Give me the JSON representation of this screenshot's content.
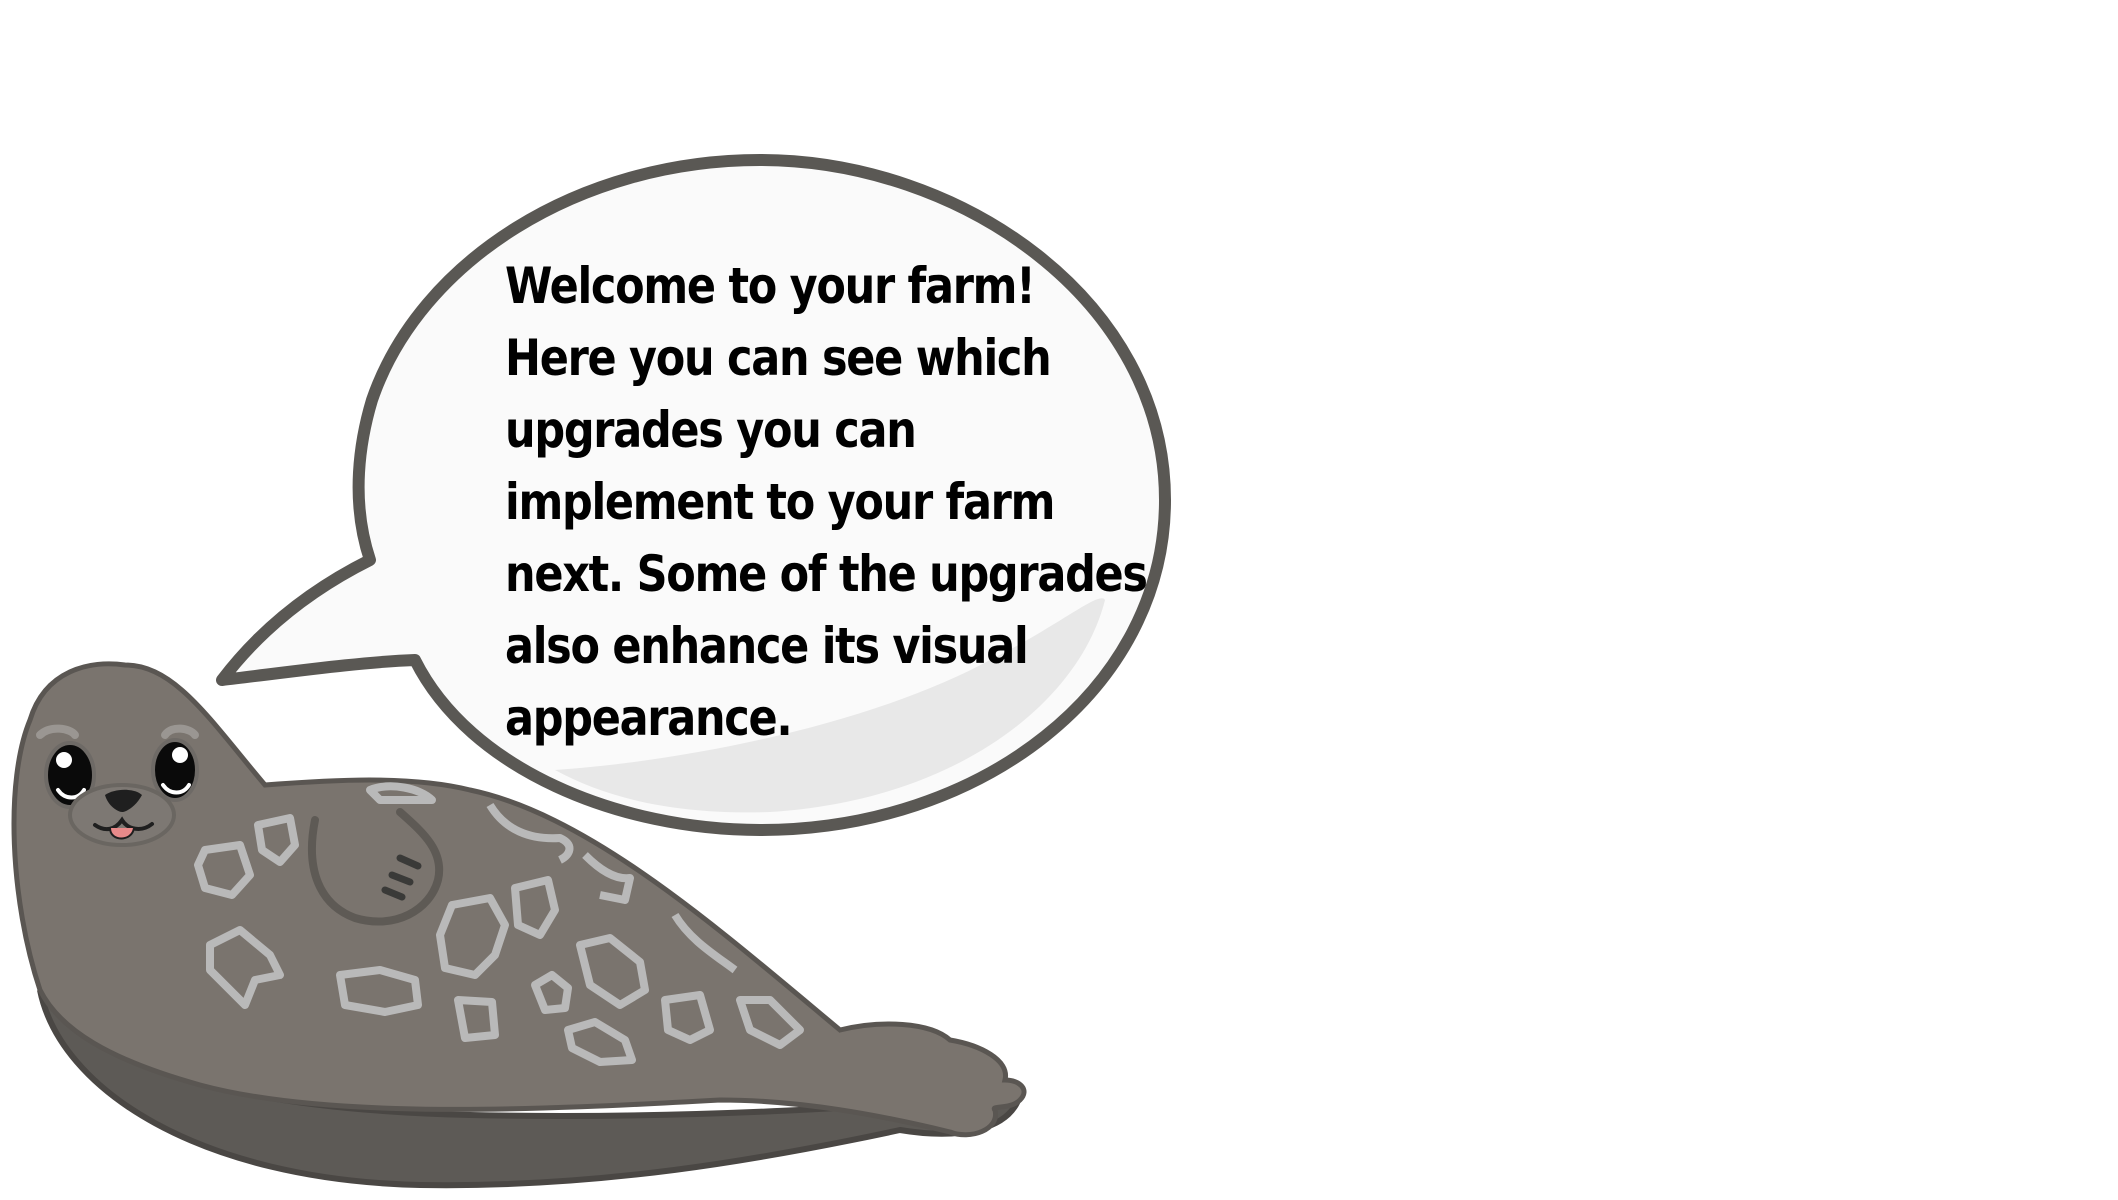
{
  "dialog": {
    "lines": [
      "Welcome to your farm!",
      "Here you can see which",
      "upgrades you can",
      "implement to your farm",
      "next. Some of the upgrades",
      "also enhance its visual",
      "appearance."
    ]
  },
  "colors": {
    "background": "#ffffff",
    "bubble_fill": "#fafafa",
    "bubble_outline": "#5a5854",
    "bubble_shade": "#e8e8e8",
    "seal_body": "#7a746e",
    "seal_belly_shadow": "#5d5a56",
    "seal_spots": "#b9b9b9",
    "text": "#000000"
  },
  "icons": [
    "seal-guide-character",
    "speech-bubble"
  ]
}
